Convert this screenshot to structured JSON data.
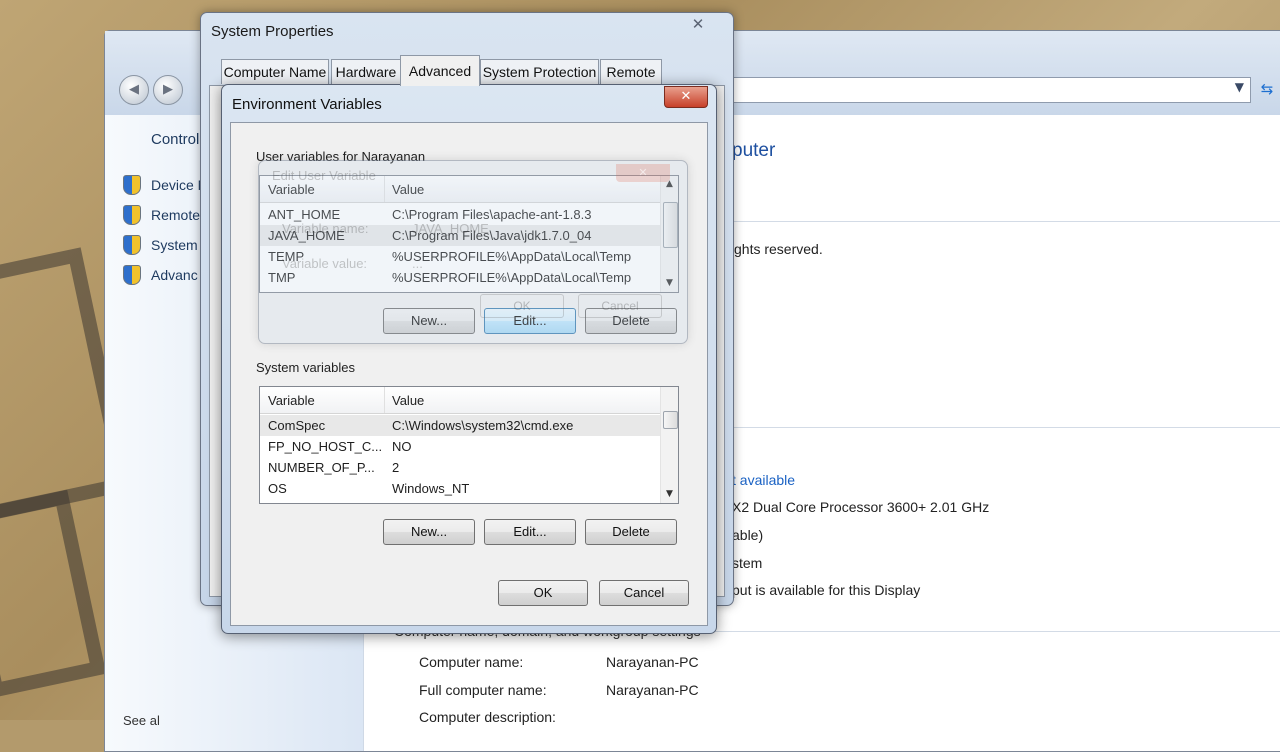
{
  "control_panel": {
    "home_link": "Control",
    "links": [
      "Device M",
      "Remote",
      "System",
      "Advanc"
    ],
    "heading_fragment": "puter",
    "rights_fragment": "ghts reserved.",
    "rating_link_fragment": "t available",
    "processor_fragment": "X2 Dual Core Processor 3600+   2.01 GHz",
    "memory_fragment": "able)",
    "system_type_fragment": "stem",
    "pen_fragment": "put is available for this Display",
    "section_title": "Computer name, domain, and workgroup settings",
    "computer_name_label": "Computer name:",
    "computer_name_value": "Narayanan-PC",
    "full_name_label": "Full computer name:",
    "full_name_value": "Narayanan-PC",
    "description_label": "Computer description:",
    "bottom_left_fragment": "See al"
  },
  "system_properties": {
    "title": "System Properties",
    "tabs": [
      "Computer Name",
      "Hardware",
      "Advanced",
      "System Protection",
      "Remote"
    ],
    "active_tab": "Advanced"
  },
  "env_dialog": {
    "title": "Environment Variables",
    "user_group_title": "User variables for Narayanan",
    "system_group_title": "System variables",
    "col_variable": "Variable",
    "col_value": "Value",
    "user_vars": [
      {
        "variable": "ANT_HOME",
        "value": "C:\\Program Files\\apache-ant-1.8.3"
      },
      {
        "variable": "JAVA_HOME",
        "value": "C:\\Program Files\\Java\\jdk1.7.0_04"
      },
      {
        "variable": "TEMP",
        "value": "%USERPROFILE%\\AppData\\Local\\Temp"
      },
      {
        "variable": "TMP",
        "value": "%USERPROFILE%\\AppData\\Local\\Temp"
      }
    ],
    "system_vars": [
      {
        "variable": "ComSpec",
        "value": "C:\\Windows\\system32\\cmd.exe"
      },
      {
        "variable": "FP_NO_HOST_C...",
        "value": "NO"
      },
      {
        "variable": "NUMBER_OF_P...",
        "value": "2"
      },
      {
        "variable": "OS",
        "value": "Windows_NT"
      }
    ],
    "buttons": {
      "new": "New...",
      "edit": "Edit...",
      "delete": "Delete",
      "ok": "OK",
      "cancel": "Cancel"
    }
  },
  "ghost_dialog": {
    "title": "Edit User Variable",
    "name_label": "Variable name:",
    "name_value": "JAVA_HOME",
    "value_label": "Variable value:",
    "value_value": "...",
    "ok": "OK",
    "cancel": "Cancel"
  },
  "icons": {
    "back": "back-arrow-icon",
    "forward": "forward-arrow-icon",
    "close": "close-icon",
    "shield": "uac-shield-icon",
    "refresh": "refresh-icon"
  }
}
